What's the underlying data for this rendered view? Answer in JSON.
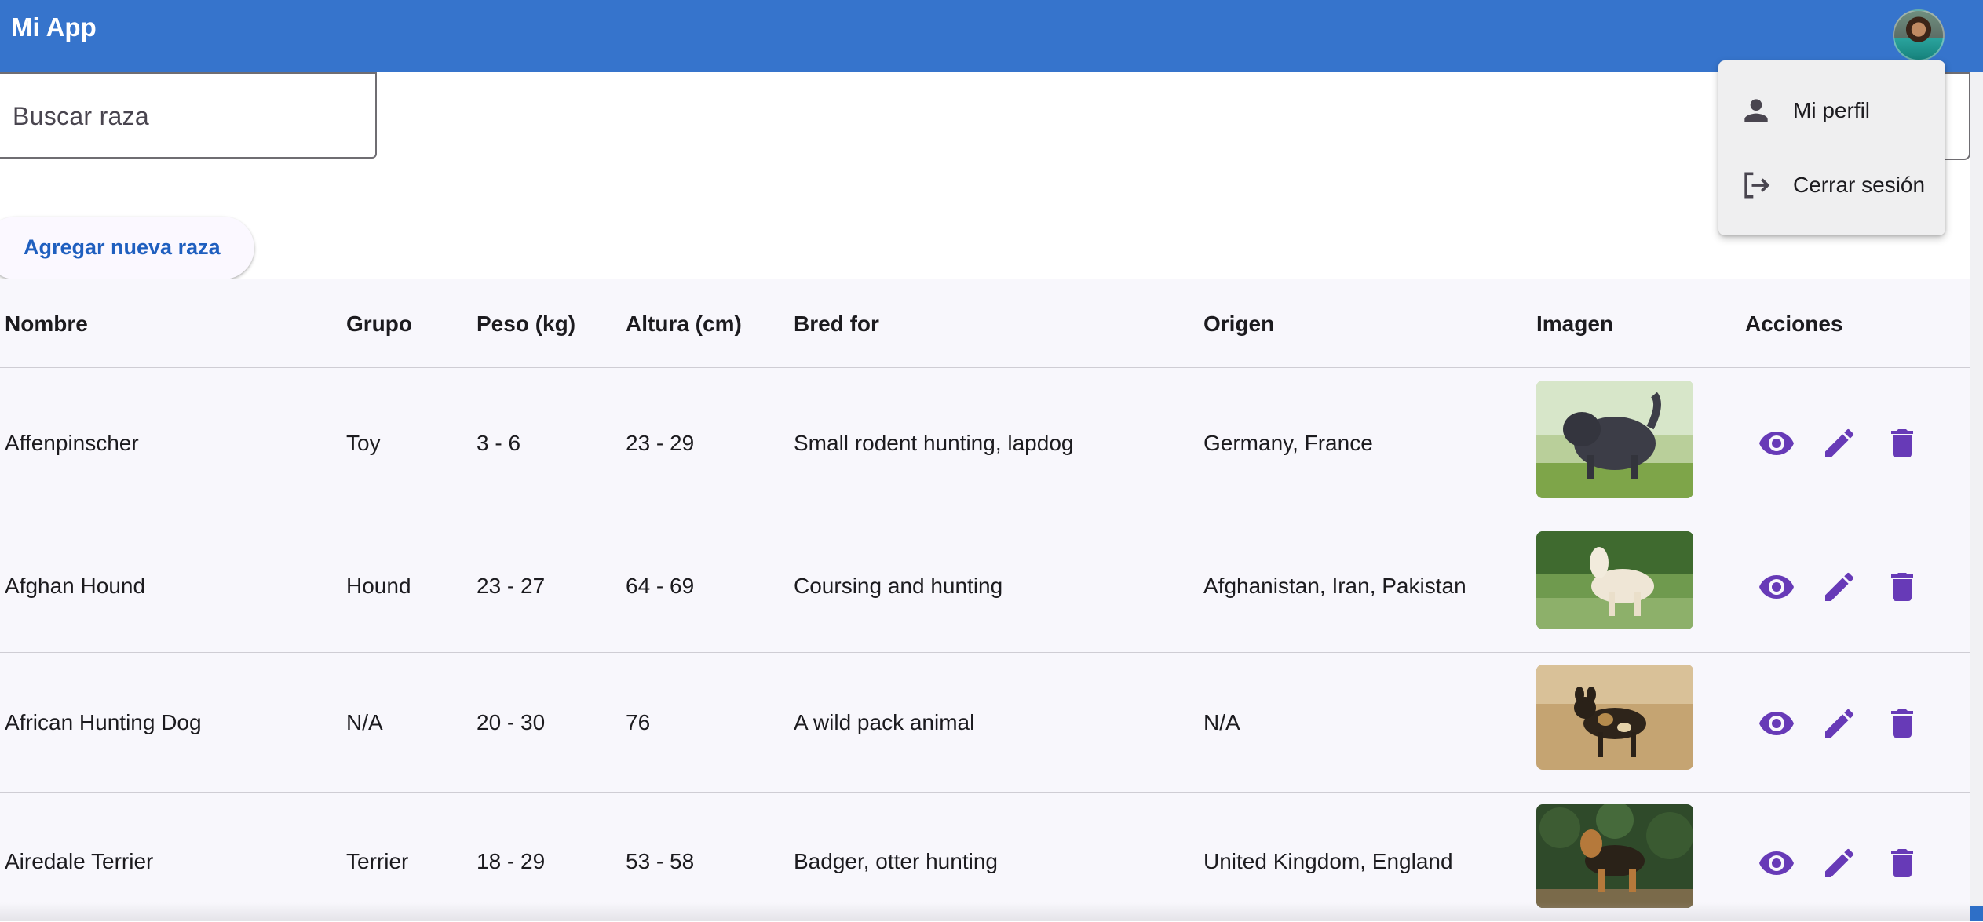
{
  "app": {
    "title": "Mi App"
  },
  "search": {
    "placeholder": "Buscar raza"
  },
  "actions": {
    "add_label": "Agregar nueva raza"
  },
  "table": {
    "headers": [
      "Nombre",
      "Grupo",
      "Peso (kg)",
      "Altura (cm)",
      "Bred for",
      "Origen",
      "Imagen",
      "Acciones"
    ],
    "rows": [
      {
        "nombre": "Affenpinscher",
        "grupo": "Toy",
        "peso": "3 - 6",
        "altura": "23 - 29",
        "bred_for": "Small rodent hunting, lapdog",
        "origen": "Germany, France"
      },
      {
        "nombre": "Afghan Hound",
        "grupo": "Hound",
        "peso": "23 - 27",
        "altura": "64 - 69",
        "bred_for": "Coursing and hunting",
        "origen": "Afghanistan, Iran, Pakistan"
      },
      {
        "nombre": "African Hunting Dog",
        "grupo": "N/A",
        "peso": "20 - 30",
        "altura": "76",
        "bred_for": "A wild pack animal",
        "origen": "N/A"
      },
      {
        "nombre": "Airedale Terrier",
        "grupo": "Terrier",
        "peso": "18 - 29",
        "altura": "53 - 58",
        "bred_for": "Badger, otter hunting",
        "origen": "United Kingdom, England"
      }
    ],
    "row_icons": [
      "eye-icon",
      "pencil-icon",
      "trash-icon"
    ]
  },
  "user_menu": {
    "items": [
      {
        "label": "Mi perfil",
        "icon": "person-icon"
      },
      {
        "label": "Cerrar sesión",
        "icon": "logout-icon"
      }
    ]
  },
  "colors": {
    "app_bar": "#3674cc",
    "accent": "#673ab7",
    "link": "#1f5fbf",
    "table_bg": "#f8f7fc"
  }
}
